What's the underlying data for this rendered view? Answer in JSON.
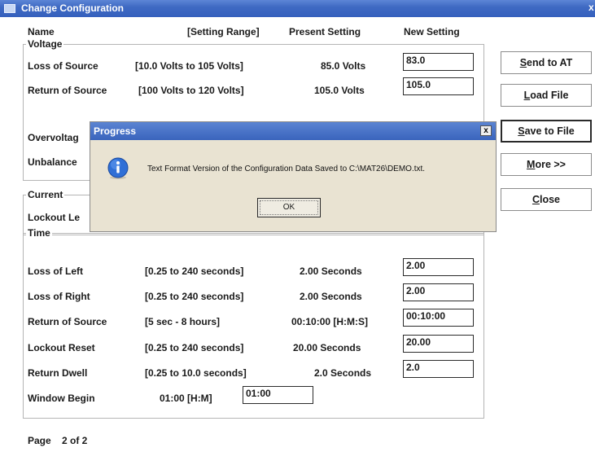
{
  "window": {
    "title": "Change Configuration",
    "close": "x"
  },
  "headers": {
    "name": "Name",
    "range": "[Setting Range]",
    "present": "Present Setting",
    "new": "New Setting"
  },
  "voltage": {
    "group": "Voltage",
    "rows": [
      {
        "name": "Loss of Source",
        "range": "[10.0 Volts to 105 Volts]",
        "present": "85.0 Volts",
        "value": "83.0"
      },
      {
        "name": "Return of Source",
        "range": "[100 Volts to 120 Volts]",
        "present": "105.0 Volts",
        "value": "105.0"
      },
      {
        "name": "Overvoltag"
      },
      {
        "name": "Unbalance"
      }
    ]
  },
  "current": {
    "group": "Current",
    "rows": [
      {
        "name": "Lockout Le"
      }
    ]
  },
  "time": {
    "group": "Time",
    "rows": [
      {
        "name": "Loss of Left",
        "range": "[0.25 to 240 seconds]",
        "present": "2.00 Seconds",
        "value": "2.00"
      },
      {
        "name": "Loss of Right",
        "range": "[0.25 to 240 seconds]",
        "present": "2.00 Seconds",
        "value": "2.00"
      },
      {
        "name": "Return of Source",
        "range": "[5 sec - 8 hours]",
        "present": "00:10:00 [H:M:S]",
        "value": "00:10:00"
      },
      {
        "name": "Lockout Reset",
        "range": "[0.25 to 240 seconds]",
        "present": "20.00 Seconds",
        "value": "20.00"
      },
      {
        "name": "Return Dwell",
        "range": "[0.25 to 10.0 seconds]",
        "present": "2.0 Seconds",
        "value": "2.0"
      }
    ],
    "window_begin": {
      "name": "Window Begin",
      "present": "01:00 [H:M]",
      "value": "01:00"
    }
  },
  "buttons": {
    "send": {
      "key": "S",
      "rest": "end to AT"
    },
    "load": {
      "key": "L",
      "rest": "oad File"
    },
    "save": {
      "key": "S",
      "rest": "ave to File"
    },
    "more": {
      "key": "M",
      "rest": "ore >>"
    },
    "close": {
      "key": "C",
      "rest": "lose"
    }
  },
  "page": {
    "label": "Page",
    "value": "2 of 2"
  },
  "dialog": {
    "title": "Progress",
    "close": "x",
    "message": "Text Format Version of the Configuration Data Saved to C:\\MAT26\\DEMO.txt.",
    "ok": "OK",
    "icon": "info-icon"
  },
  "colors": {
    "titlebar": "#3f6ac3",
    "dialog_bg": "#e9e3d2",
    "info_blue": "#2f6fd6"
  }
}
